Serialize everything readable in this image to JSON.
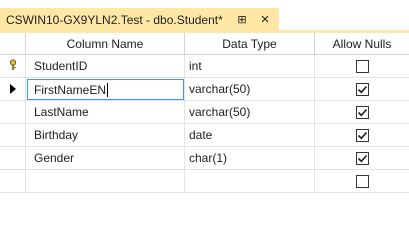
{
  "tab": {
    "title": "CSWIN10-GX9YLN2.Test - dbo.Student*",
    "pin_icon": "pin-icon",
    "close_icon": "close-icon",
    "accent": "#ffe8a6"
  },
  "grid": {
    "headers": {
      "name": "Column Name",
      "type": "Data Type",
      "nulls": "Allow Nulls"
    },
    "rows": [
      {
        "name": "StudentID",
        "type": "int",
        "allow_nulls": false,
        "indicator": "key-icon"
      },
      {
        "name": "FirstNameEN",
        "type": "varchar(50)",
        "allow_nulls": true,
        "indicator": "current-row-arrow-icon",
        "editing": true
      },
      {
        "name": "LastName",
        "type": "varchar(50)",
        "allow_nulls": true
      },
      {
        "name": "Birthday",
        "type": "date",
        "allow_nulls": true
      },
      {
        "name": "Gender",
        "type": "char(1)",
        "allow_nulls": true
      },
      {
        "name": "",
        "type": "",
        "allow_nulls": false
      }
    ]
  }
}
